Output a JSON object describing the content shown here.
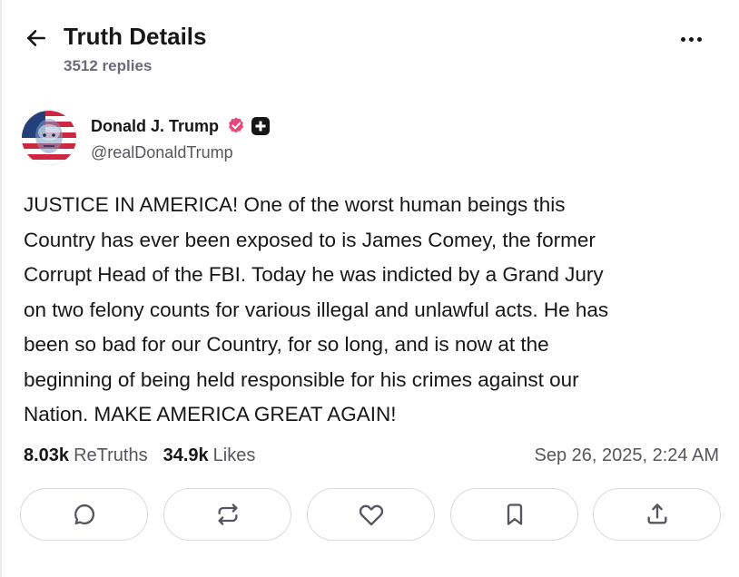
{
  "header": {
    "title": "Truth Details",
    "replies": "3512 replies",
    "icons": {
      "back": "arrow-left-icon",
      "more": "more-horizontal-icon"
    }
  },
  "author": {
    "name": "Donald J. Trump",
    "handle": "@realDonaldTrump",
    "icons": {
      "verified": "verified-badge-icon",
      "plus": "plus-badge-icon"
    }
  },
  "post": {
    "text": "JUSTICE IN AMERICA! One of the worst human beings this Country has ever been exposed to is James Comey, the former Corrupt Head of the FBI. Today he was indicted by a Grand Jury on two felony counts for various illegal and unlawful acts. He has been so bad for our Country, for so long, and is now at the beginning of being held responsible for his crimes against our Nation. MAKE AMERICA GREAT AGAIN!",
    "lines": [
      "JUSTICE IN AMERICA! One of the worst human beings this",
      "Country has ever been exposed to is James Comey, the former",
      "Corrupt Head of the FBI. Today he was indicted by a Grand Jury",
      "on two felony counts for various illegal and unlawful acts. He has",
      "been so bad for our Country, for so long, and is now at the",
      "beginning of being held responsible for his crimes against our",
      "Nation. MAKE AMERICA GREAT AGAIN!"
    ]
  },
  "stats": {
    "retruths_value": "8.03k",
    "retruths_label": "ReTruths",
    "likes_value": "34.9k",
    "likes_label": "Likes"
  },
  "timestamp": "Sep 26, 2025, 2:24 AM",
  "actions": [
    {
      "name": "reply",
      "icon": "reply-bubble-icon"
    },
    {
      "name": "retruth",
      "icon": "retruth-icon"
    },
    {
      "name": "like",
      "icon": "heart-icon"
    },
    {
      "name": "bookmark",
      "icon": "bookmark-icon"
    },
    {
      "name": "share",
      "icon": "share-icon"
    }
  ],
  "colors": {
    "text": "#17171a",
    "muted": "#55555f",
    "border": "#d9d9e0",
    "verified": "#e8477a"
  }
}
